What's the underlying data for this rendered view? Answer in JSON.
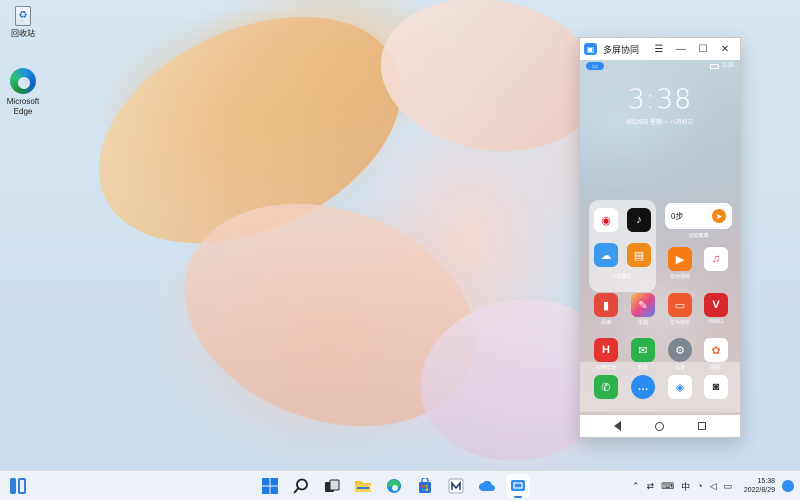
{
  "desktop": {
    "icons": [
      {
        "label": "回收站",
        "icon": "recycle-bin-icon"
      },
      {
        "label": "Microsoft Edge",
        "icon": "edge-icon"
      }
    ]
  },
  "window": {
    "title": "多屏协同",
    "buttons": {
      "menu": "☰",
      "minimize": "—",
      "maximize": "☐",
      "close": "✕"
    }
  },
  "phone": {
    "status_bar": {
      "time": "3:38"
    },
    "lock_clock": "3:38",
    "date": "8月29日 星期一    八月初三",
    "widget": {
      "steps": "0步",
      "label": "运动健康"
    },
    "apps": [
      {
        "label": "",
        "name": "weibo",
        "color": "#e6162d",
        "glyph": "◉"
      },
      {
        "label": "",
        "name": "tiktok",
        "color": "#111111",
        "glyph": "♪"
      },
      {
        "label": "",
        "name": "cloud",
        "color": "#3a9af0",
        "glyph": "☁"
      },
      {
        "label": "",
        "name": "docs",
        "color": "#f08a1a",
        "glyph": "▤"
      },
      {
        "label": "华为视频",
        "name": "huawei-video",
        "color": "#f57c12",
        "glyph": "▶"
      },
      {
        "label": "",
        "name": "music",
        "color": "#ffffff",
        "glyph": "♫"
      },
      {
        "label": "阅读",
        "name": "reading",
        "color": "#e34a3b",
        "glyph": "▮"
      },
      {
        "label": "主题",
        "name": "themes",
        "color": "#e94a86",
        "glyph": "✎"
      },
      {
        "label": "华为钱包",
        "name": "wallet",
        "color": "#ee5a2c",
        "glyph": "▭"
      },
      {
        "label": "VMALL",
        "name": "vmall",
        "color": "#d7262c",
        "glyph": "V"
      },
      {
        "label": "应用市场",
        "name": "app-gallery",
        "color": "#e4332e",
        "glyph": "H"
      },
      {
        "label": "畅连",
        "name": "meetime",
        "color": "#2bb24c",
        "glyph": "✉"
      },
      {
        "label": "设置",
        "name": "settings",
        "color": "#7d8790",
        "glyph": "⚙"
      },
      {
        "label": "图库",
        "name": "gallery",
        "color": "#ffffff",
        "glyph": "✿"
      }
    ],
    "folder_label": "小艺建议",
    "dock": [
      {
        "name": "phone",
        "color": "#2bb24c",
        "glyph": "✆"
      },
      {
        "name": "messages",
        "color": "#2a8cf0",
        "glyph": "…"
      },
      {
        "name": "browser",
        "color": "#ffffff",
        "glyph": "◈"
      },
      {
        "name": "camera",
        "color": "#ffffff",
        "glyph": "◙"
      }
    ]
  },
  "taskbar": {
    "apps": [
      {
        "name": "start",
        "active": false
      },
      {
        "name": "search",
        "active": false
      },
      {
        "name": "task-view",
        "active": false
      },
      {
        "name": "file-explorer",
        "active": false
      },
      {
        "name": "edge",
        "active": false
      },
      {
        "name": "store",
        "active": false
      },
      {
        "name": "huawei-pc-manager",
        "active": false
      },
      {
        "name": "cloud-app",
        "active": false
      },
      {
        "name": "multi-screen",
        "active": true
      }
    ],
    "tray": {
      "ime": "中",
      "time": "15:38",
      "date": "2022/8/29"
    }
  }
}
